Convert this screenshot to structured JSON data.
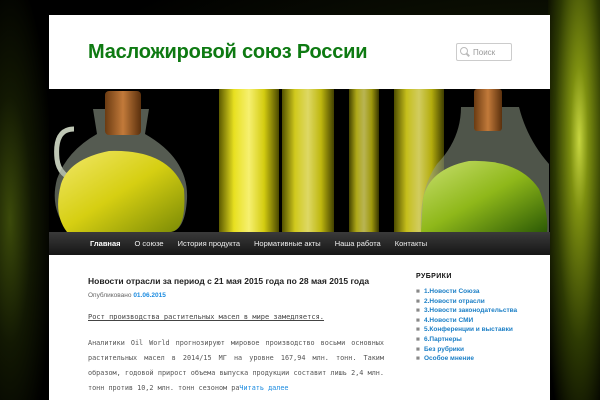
{
  "site": {
    "title": "Масложировой союз России"
  },
  "search": {
    "placeholder": "Поиск"
  },
  "nav": {
    "items": [
      {
        "label": "Главная"
      },
      {
        "label": "О союзе"
      },
      {
        "label": "История продукта"
      },
      {
        "label": "Нормативные акты"
      },
      {
        "label": "Наша работа"
      },
      {
        "label": "Контакты"
      }
    ]
  },
  "article": {
    "title": "Новости отрасли за период с 21 мая 2015 года по 28 мая 2015 года",
    "meta_prefix": "Опубликовано",
    "date": "01.06.2015",
    "lead": "Рост производства растительных масел в мире замедляется.",
    "body": "Аналитики Oil World прогнозируют мировое производство восьми основных растительных масел в 2014/15 МГ на уровне 167,94 млн. тонн. Таким образом, годовой прирост объема выпуска продукции составит лишь 2,4 млн. тонн против 10,2 млн. тонн сезоном ра",
    "more": "Читать далее"
  },
  "sidebar": {
    "title": "РУБРИКИ",
    "items": [
      {
        "label": "1.Новости Союза"
      },
      {
        "label": "2.Новости отрасли"
      },
      {
        "label": "3.Новости законодательства"
      },
      {
        "label": "4.Новости СМИ"
      },
      {
        "label": "5.Конференции и выставки"
      },
      {
        "label": "6.Партнеры"
      },
      {
        "label": "Без рубрики"
      },
      {
        "label": "Особое мнение"
      }
    ]
  },
  "colors": {
    "title_green": "#0e7a12",
    "link_blue": "#1b8be0",
    "nav_bg": "#222222",
    "oil_yellow": "#d6cf12"
  },
  "icons": [
    "search-icon",
    "bullet-icon"
  ]
}
